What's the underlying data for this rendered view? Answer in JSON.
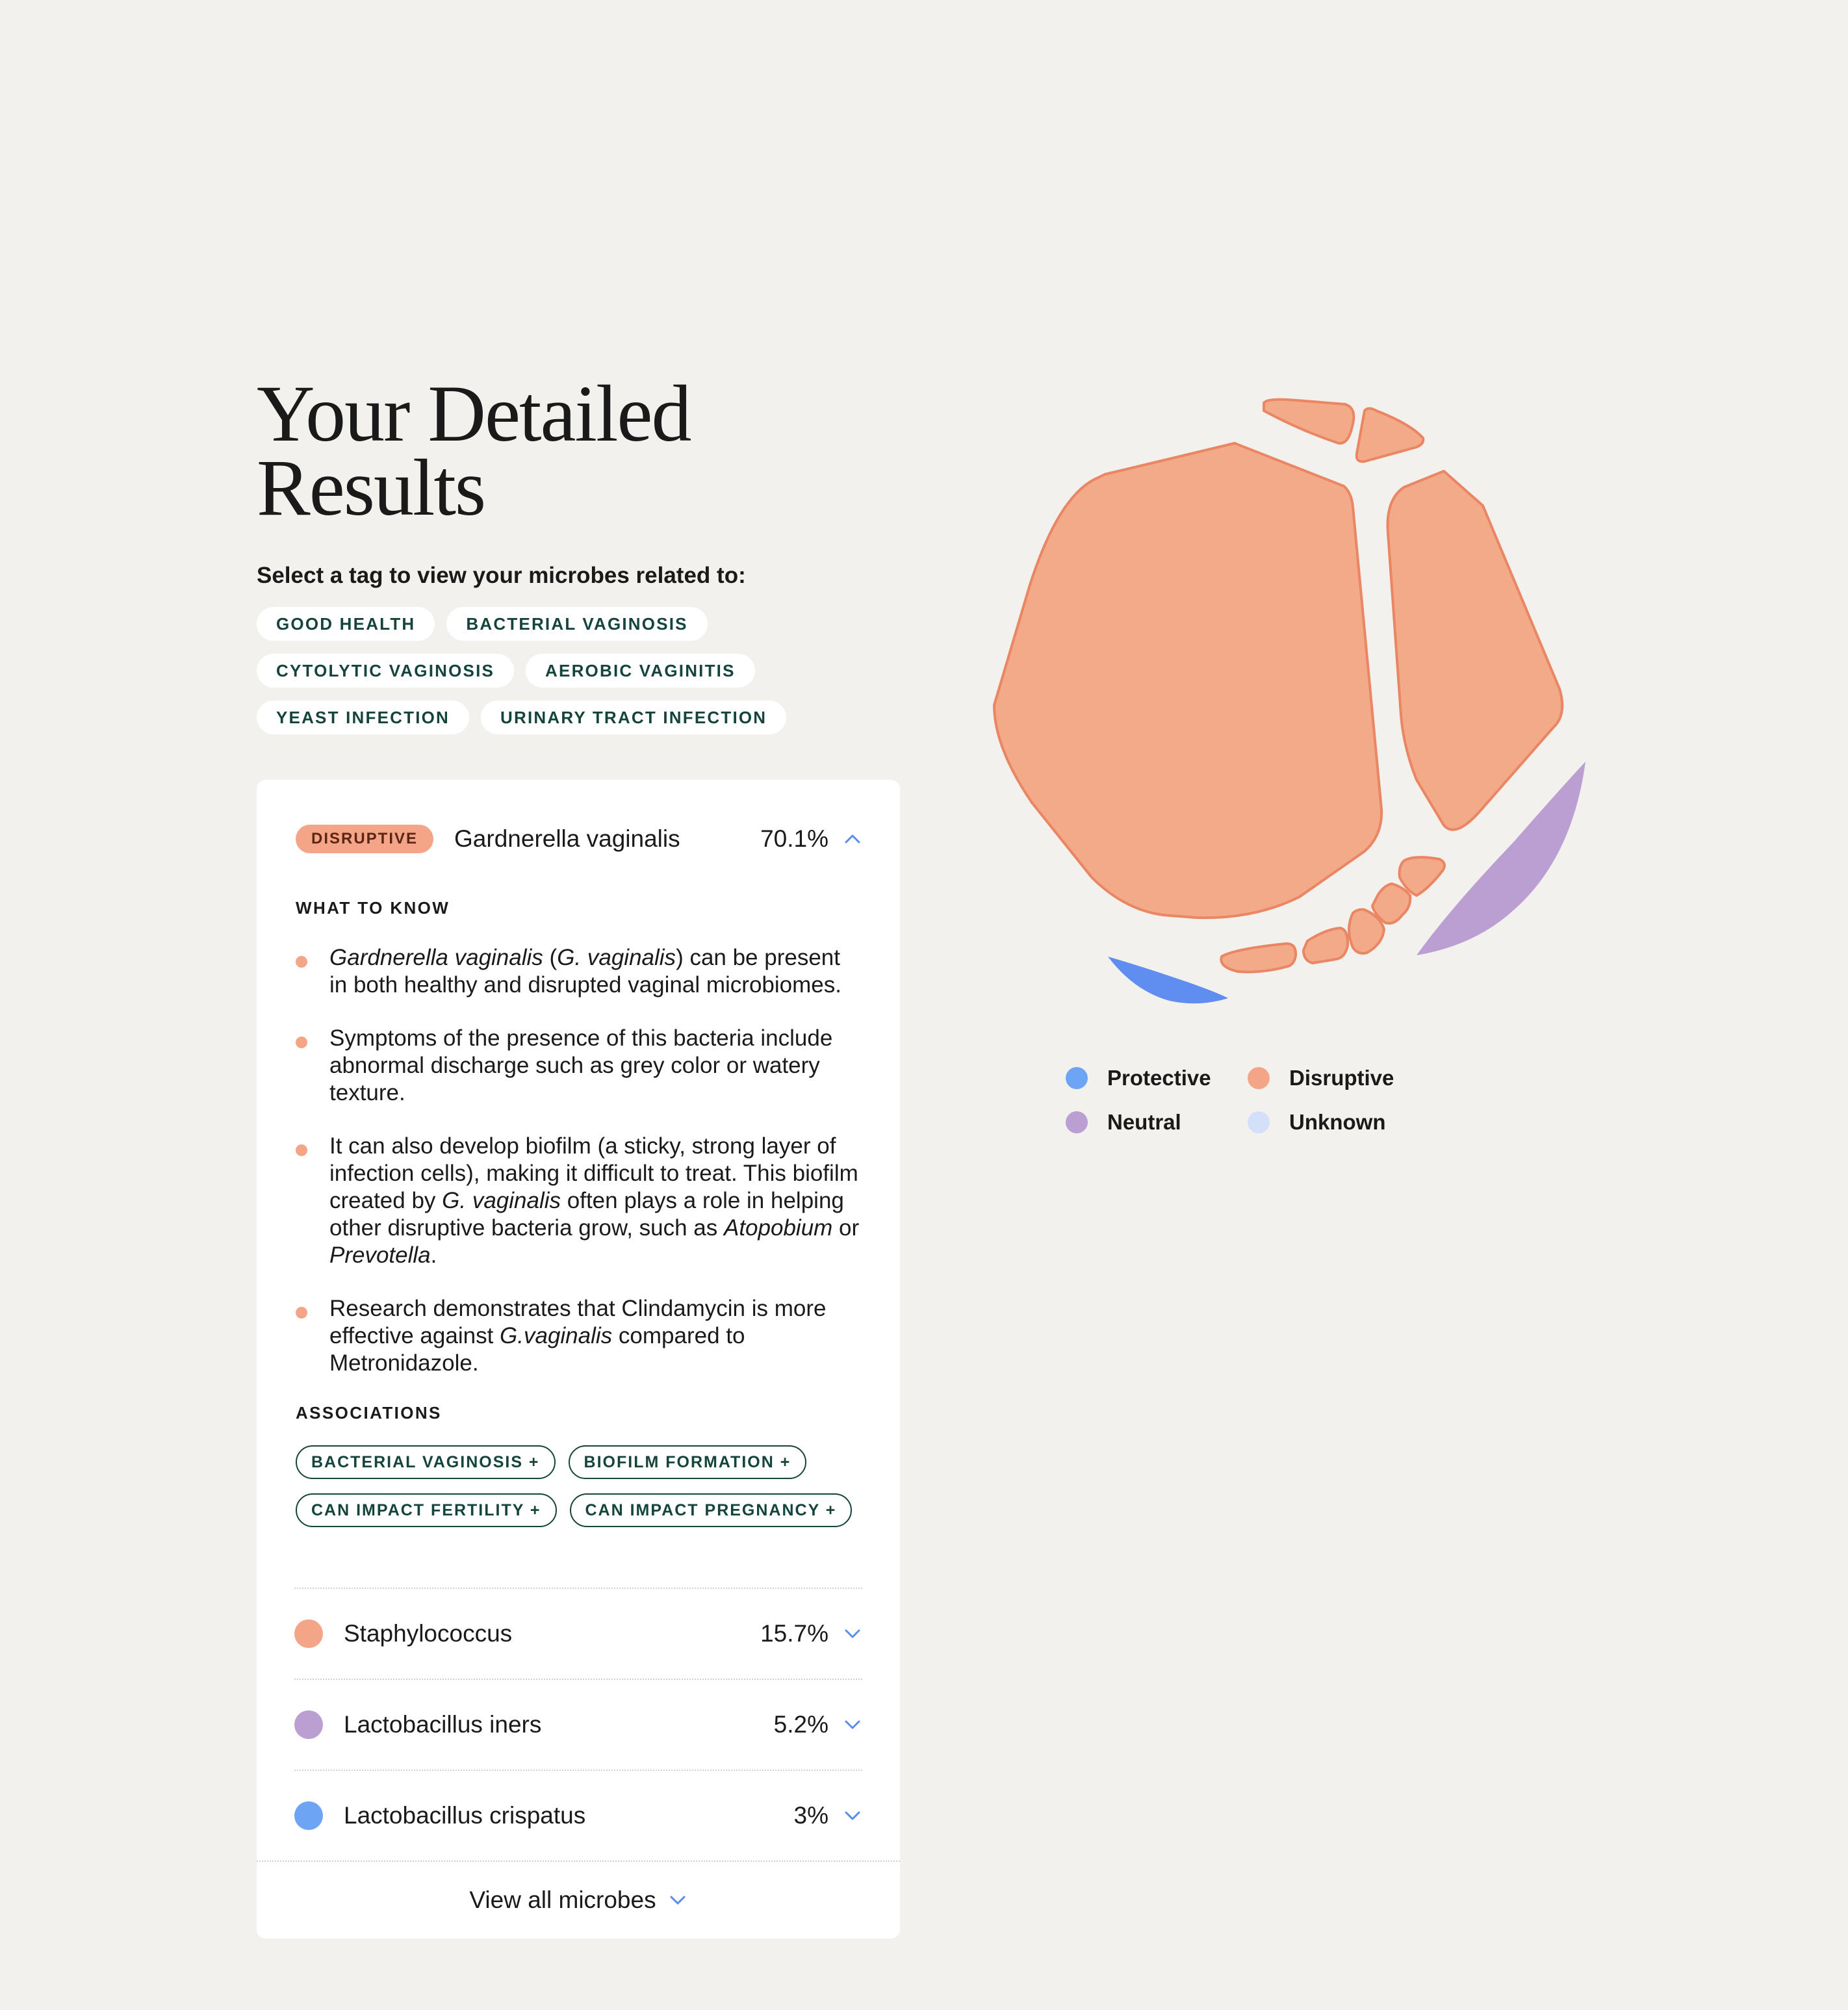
{
  "title_lines": [
    "Your Detailed",
    "Results"
  ],
  "prompt": "Select a tag to view your microbes related to:",
  "tags": [
    "GOOD HEALTH",
    "BACTERIAL VAGINOSIS",
    "CYTOLYTIC VAGINOSIS",
    "AEROBIC VAGINITIS",
    "YEAST INFECTION",
    "URINARY TRACT INFECTION"
  ],
  "expanded": {
    "badge": "DISRUPTIVE",
    "name": "Gardnerella vaginalis",
    "percent": "70.1%",
    "what_to_know_label": "WHAT TO KNOW",
    "associations_label": "ASSOCIATIONS",
    "bullets": [
      {
        "a_italic": "Gardnerella vaginalis",
        "b": " (",
        "c_italic": "G. vaginalis",
        "d": ") can be present in both healthy and disrupted vaginal microbiomes."
      },
      {
        "text": "Symptoms of the presence of this bacteria include abnormal discharge such as grey color or watery texture."
      },
      {
        "a": "It can also develop biofilm (a sticky, strong layer of infection cells), making it difficult to treat. This biofilm created by ",
        "b_italic": "G. vaginalis",
        "c": " often plays a role in helping other disruptive bacteria grow, such as ",
        "d_italic": "Atopobium",
        "e": " or ",
        "f_italic": "Prevotella",
        "g": "."
      },
      {
        "a": "Research demonstrates that Clindamycin is more effective against ",
        "b_italic": "G.vaginalis",
        "c": " compared to Metronidazole."
      }
    ],
    "associations": [
      "BACTERIAL VAGINOSIS +",
      "BIOFILM FORMATION +",
      "CAN IMPACT FERTILITY +",
      "CAN IMPACT PREGNANCY +"
    ]
  },
  "rows": [
    {
      "name": "Staphylococcus",
      "percent": "15.7%",
      "color": "#f5a587"
    },
    {
      "name": "Lactobacillus iners",
      "percent": "5.2%",
      "color": "#bb9ed2"
    },
    {
      "name": "Lactobacillus crispatus",
      "percent": "3%",
      "color": "#6ea4f4"
    }
  ],
  "view_all": "View all microbes",
  "legend": [
    {
      "label": "Protective",
      "color": "#6ea4f4"
    },
    {
      "label": "Disruptive",
      "color": "#f5a587"
    },
    {
      "label": "Neutral",
      "color": "#bb9ed2"
    },
    {
      "label": "Unknown",
      "color": "#d3e0fa"
    }
  ],
  "colors": {
    "accent": "#14443c",
    "disruptive": "#f5a587",
    "disruptive_stroke": "#ea8663",
    "neutral": "#bb9ed2",
    "protective": "#6ea4f4",
    "chevron": "#5a8ee6"
  }
}
